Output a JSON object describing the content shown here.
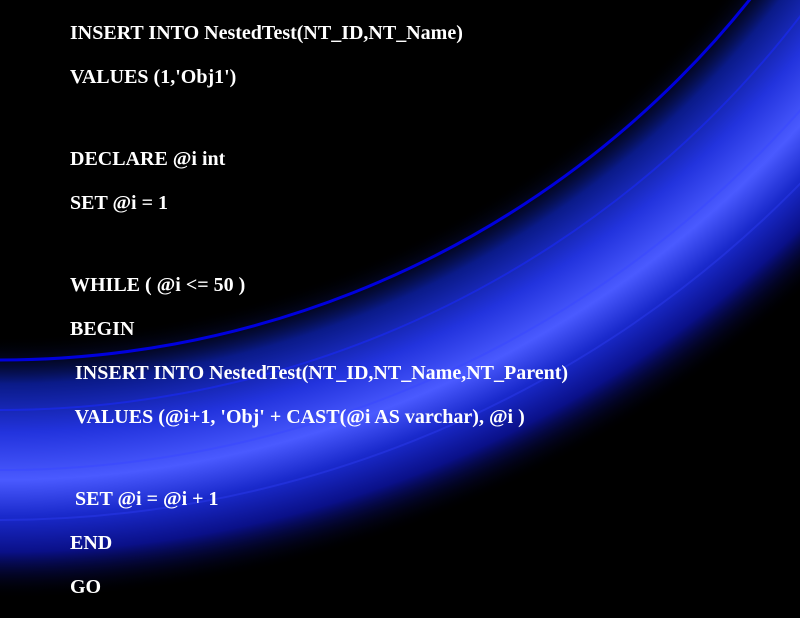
{
  "code": {
    "line1": "INSERT INTO NestedTest(NT_ID,NT_Name)",
    "line2": "VALUES (1,'Obj1')",
    "line3": "DECLARE @i int",
    "line4": "SET @i = 1",
    "line5": "WHILE ( @i <= 50 )",
    "line6": "BEGIN",
    "line7": " INSERT INTO NestedTest(NT_ID,NT_Name,NT_Parent)",
    "line8": " VALUES (@i+1, 'Obj' + CAST(@i AS varchar), @i )",
    "line9": " SET @i = @i + 1",
    "line10": "END",
    "line11": "GO"
  },
  "colors": {
    "background": "#000000",
    "text": "#ffffff",
    "arc_blue_dark": "#0000aa",
    "arc_blue_light": "#3344ff"
  }
}
